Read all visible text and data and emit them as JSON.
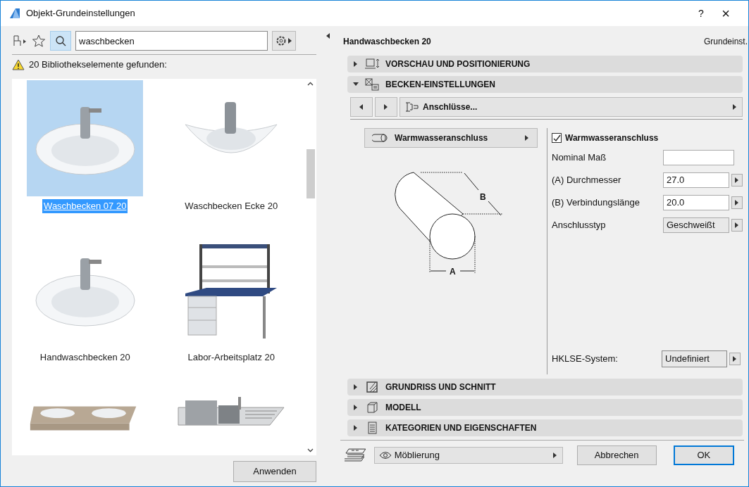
{
  "window": {
    "title": "Objekt-Grundeinstellungen",
    "help": "?",
    "close": "×"
  },
  "library": {
    "search": {
      "value": "waschbecken"
    },
    "warning": "20 Bibliothekselemente gefunden:",
    "items": [
      {
        "label": "Waschbecken 07 20",
        "selected": true,
        "kind": "basin"
      },
      {
        "label": "Waschbecken Ecke 20",
        "selected": false,
        "kind": "corner"
      },
      {
        "label": "Handwaschbecken 20",
        "selected": false,
        "kind": "basin"
      },
      {
        "label": "Labor-Arbeitsplatz 20",
        "selected": false,
        "kind": "lab"
      },
      {
        "selected": false,
        "kind": "vanity"
      },
      {
        "selected": false,
        "kind": "sink"
      }
    ],
    "apply_button": "Anwenden"
  },
  "settings": {
    "object_name": "Handwaschbecken 20",
    "tab_label": "Grundeinst.",
    "sections_top": [
      {
        "title": "VORSCHAU UND POSITIONIERUNG",
        "expanded": false,
        "kind": "preview"
      },
      {
        "title": "BECKEN-EINSTELLUNGEN",
        "expanded": true,
        "kind": "settings"
      }
    ],
    "page_nav": {
      "label": "Anschlüsse..."
    },
    "part_button": "Warmwasseranschluss",
    "diagram": {
      "label_a": "A",
      "label_b": "B"
    },
    "checkbox": {
      "label": "Warmwasseranschluss",
      "checked": true
    },
    "fields": [
      {
        "label": "Nominal Maß",
        "kind": "input"
      },
      {
        "label": "(A) Durchmesser",
        "value": "27.0",
        "kind": "spinner"
      },
      {
        "label": "(B) Verbindungslänge",
        "value": "20.0",
        "kind": "spinner"
      },
      {
        "label": "Anschlusstyp",
        "value": "Geschweißt",
        "kind": "dropdown"
      }
    ],
    "system": {
      "label": "HKLSE-System:",
      "value": "Undefiniert"
    },
    "sections_bottom": [
      {
        "title": "GRUNDRISS UND SCHNITT",
        "expanded": false,
        "kind": "plan"
      },
      {
        "title": "MODELL",
        "expanded": false,
        "kind": "model"
      },
      {
        "title": "KATEGORIEN UND EIGENSCHAFTEN",
        "expanded": false,
        "kind": "list"
      }
    ]
  },
  "footer": {
    "layer": "Möblierung",
    "cancel": "Abbrechen",
    "ok": "OK"
  }
}
